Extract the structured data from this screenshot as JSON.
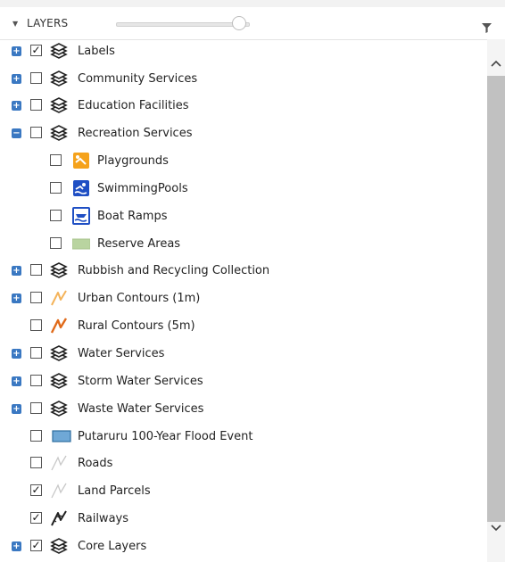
{
  "panel": {
    "title": "LAYERS",
    "opacity_slider_level": 0.88
  },
  "layers": [
    {
      "label": "Labels",
      "expander": "+",
      "checked": "✓",
      "icon": "layers-stack-icon"
    },
    {
      "label": "Community Services",
      "expander": "+",
      "checked": "",
      "icon": "layers-stack-icon"
    },
    {
      "label": "Education Facilities",
      "expander": "+",
      "checked": "",
      "icon": "layers-stack-icon"
    },
    {
      "label": "Recreation Services",
      "expander": "−",
      "checked": "",
      "icon": "layers-stack-icon"
    },
    {
      "label": "Playgrounds",
      "checked": "",
      "icon": "playground-icon",
      "color": "#f5a21b"
    },
    {
      "label": "SwimmingPools",
      "checked": "",
      "icon": "swimming-pool-icon",
      "color": "#1f4fc4"
    },
    {
      "label": "Boat Ramps",
      "checked": "",
      "icon": "boat-ramp-icon",
      "color": "#1f4fc4"
    },
    {
      "label": "Reserve Areas",
      "checked": "",
      "icon": "reserve-area-swatch",
      "color": "#b9d4a0"
    },
    {
      "label": "Rubbish and Recycling Collection",
      "expander": "+",
      "checked": "",
      "icon": "layers-stack-icon"
    },
    {
      "label": "Urban Contours (1m)",
      "expander": "+",
      "checked": "",
      "icon": "contour-line-icon",
      "color": "#f4b35a"
    },
    {
      "label": "Rural Contours (5m)",
      "checked": "",
      "icon": "contour-line-icon",
      "color": "#e06a1a"
    },
    {
      "label": "Water Services",
      "expander": "+",
      "checked": "",
      "icon": "layers-stack-icon"
    },
    {
      "label": "Storm Water Services",
      "expander": "+",
      "checked": "",
      "icon": "layers-stack-icon"
    },
    {
      "label": "Waste Water Services",
      "expander": "+",
      "checked": "",
      "icon": "layers-stack-icon"
    },
    {
      "label": "Putaruru 100-Year Flood Event",
      "checked": "",
      "icon": "flood-area-swatch",
      "color": "#6fa8d6"
    },
    {
      "label": "Roads",
      "checked": "",
      "icon": "road-line-icon",
      "color": "#c8c8c8"
    },
    {
      "label": "Land Parcels",
      "checked": "✓",
      "icon": "parcel-line-icon",
      "color": "#c8c8c8"
    },
    {
      "label": "Railways",
      "checked": "✓",
      "icon": "railway-line-icon",
      "color": "#222222"
    },
    {
      "label": "Core Layers",
      "expander": "+",
      "checked": "✓",
      "icon": "layers-stack-icon"
    }
  ]
}
